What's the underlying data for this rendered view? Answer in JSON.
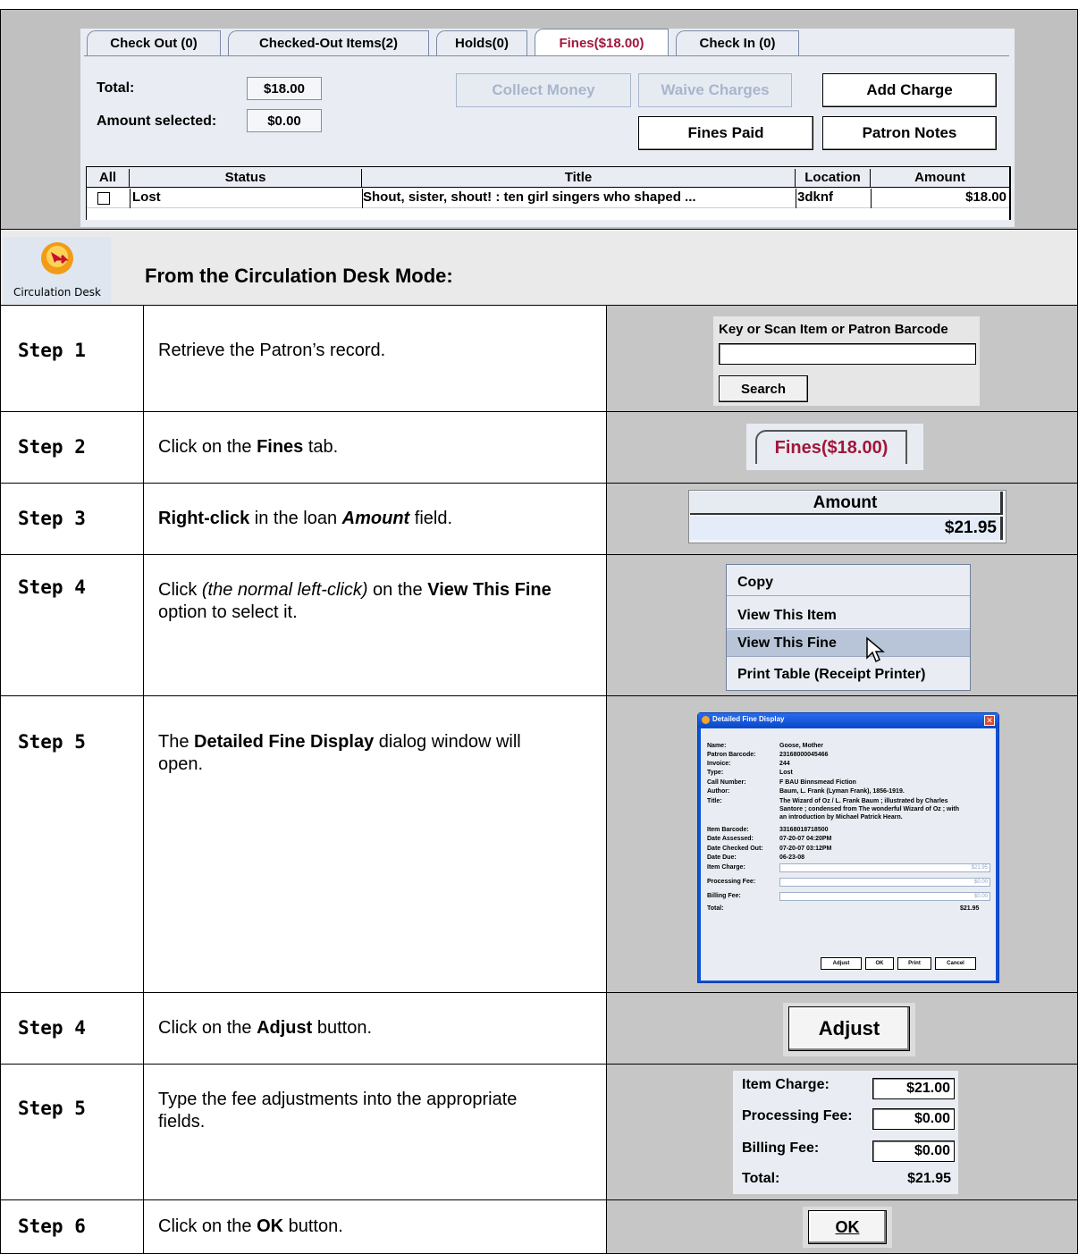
{
  "top_panel": {
    "tabs": [
      "Check Out (0)",
      "Checked-Out Items(2)",
      "Holds(0)",
      "Fines($18.00)",
      "Check In (0)"
    ],
    "total_label": "Total:",
    "total_value": "$18.00",
    "amount_selected_label": "Amount selected:",
    "amount_selected_value": "$0.00",
    "collect_money": "Collect Money",
    "waive_charges": "Waive Charges",
    "add_charge": "Add Charge",
    "fines_paid": "Fines Paid",
    "patron_notes": "Patron Notes",
    "columns": [
      "All",
      "Status",
      "Title",
      "Location",
      "Amount"
    ],
    "rows": [
      {
        "status": "Lost",
        "title": "Shout, sister, shout! : ten girl singers who shaped ...",
        "location": "3dknf",
        "amount": "$18.00"
      }
    ]
  },
  "mode": {
    "icon_label": "Circulation Desk",
    "heading": "From the Circulation Desk Mode:"
  },
  "steps": [
    {
      "label": "Step 1",
      "text": "Retrieve the Patron’s record."
    },
    {
      "label": "Step 2",
      "pre": "Click on the ",
      "bold": "Fines",
      "post": " tab."
    },
    {
      "label": "Step 3",
      "bold": "Right-click",
      "mid": " in the loan ",
      "bolditalic": "Amount",
      "post": " field."
    },
    {
      "label": "Step 4",
      "pre": "Click ",
      "italic": "(the normal left-click)",
      "mid": " on the ",
      "bold": "View This Fine",
      "post": " option to select it."
    },
    {
      "label": "Step 5",
      "pre": "The ",
      "bold": "Detailed Fine Display",
      "post": " dialog window will open."
    },
    {
      "label": "Step 4",
      "pre": "Click on the ",
      "bold": "Adjust",
      "post": " button."
    },
    {
      "label": "Step 5",
      "text": "Type the fee adjustments into the appropriate fields."
    },
    {
      "label": "Step 6",
      "pre": "Click on the ",
      "bold": "OK",
      "post": " button."
    }
  ],
  "search_widget": {
    "label": "Key or Scan Item or Patron Barcode",
    "button": "Search",
    "value": ""
  },
  "fines_tab_image": "Fines($18.00)",
  "amount_image": {
    "header": "Amount",
    "value": "$21.95"
  },
  "context_menu": [
    "Copy",
    "View This Item",
    "View This Fine",
    "Print Table (Receipt Printer)"
  ],
  "dialog": {
    "title": "Detailed Fine Display",
    "fields": [
      {
        "label": "Name:",
        "value": "Goose, Mother"
      },
      {
        "label": "Patron Barcode:",
        "value": "23168000045466"
      },
      {
        "label": "Invoice:",
        "value": "244"
      },
      {
        "label": "Type:",
        "value": "Lost"
      },
      {
        "label": "Call Number:",
        "value": "F BAU Binnsmead Fiction"
      },
      {
        "label": "Author:",
        "value": "Baum, L. Frank (Lyman Frank), 1856-1919."
      },
      {
        "label": "Title:",
        "value": "The Wizard of Oz / L. Frank Baum ; illustrated by Charles"
      },
      {
        "label": "",
        "value": "Santore ; condensed from The wonderful Wizard of Oz ; with"
      },
      {
        "label": "",
        "value": "an introduction by Michael Patrick Hearn."
      },
      {
        "label": "Item Barcode:",
        "value": "33168018718500"
      },
      {
        "label": "Date Assessed:",
        "value": "07-20-07 04:20PM"
      },
      {
        "label": "Date Checked Out:",
        "value": "07-20-07 03:12PM"
      },
      {
        "label": "Date Due:",
        "value": "06-23-08"
      }
    ],
    "charges": [
      {
        "label": "Item Charge:",
        "value": "$21.95"
      },
      {
        "label": "Processing Fee:",
        "value": "$0.00"
      },
      {
        "label": "Billing Fee:",
        "value": "$0.00"
      }
    ],
    "total_label": "Total:",
    "total_value": "$21.95",
    "buttons": [
      "Adjust",
      "OK",
      "Print",
      "Cancel"
    ]
  },
  "adjust_button": "Adjust",
  "fee_fields": [
    {
      "label": "Item Charge:",
      "value": "$21.00"
    },
    {
      "label": "Processing Fee:",
      "value": "$0.00"
    },
    {
      "label": "Billing Fee:",
      "value": "$0.00"
    }
  ],
  "fee_total": {
    "label": "Total:",
    "value": "$21.95"
  },
  "ok_button": "OK"
}
